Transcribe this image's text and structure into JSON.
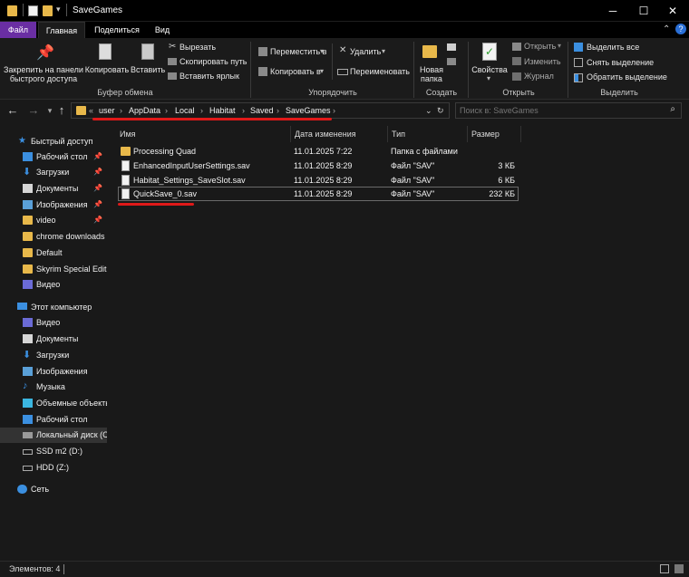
{
  "window": {
    "title": "SaveGames"
  },
  "ribbon_tabs": [
    "Файл",
    "Главная",
    "Поделиться",
    "Вид"
  ],
  "ribbon": {
    "clipboard": {
      "pin_label": "Закрепить на панели быстрого доступа",
      "copy_label": "Копировать",
      "paste_label": "Вставить",
      "cut_label": "Вырезать",
      "copy_path_label": "Скопировать путь",
      "paste_shortcut_label": "Вставить ярлык",
      "group_label": "Буфер обмена"
    },
    "organize": {
      "move_label": "Переместить в",
      "copy_to_label": "Копировать в",
      "delete_label": "Удалить",
      "rename_label": "Переименовать",
      "group_label": "Упорядочить"
    },
    "create": {
      "new_folder_label": "Новая папка",
      "group_label": "Создать"
    },
    "open": {
      "properties_label": "Свойства",
      "open_label": "Открыть",
      "edit_label": "Изменить",
      "history_label": "Журнал",
      "group_label": "Открыть"
    },
    "select": {
      "select_all_label": "Выделить все",
      "select_none_label": "Снять выделение",
      "invert_label": "Обратить выделение",
      "group_label": "Выделить"
    }
  },
  "address": {
    "overflow": "«",
    "crumbs": [
      "user",
      "AppData",
      "Local",
      "Habitat",
      "Saved",
      "SaveGames"
    ],
    "search_placeholder": "Поиск в: SaveGames"
  },
  "nav": {
    "quick_access": "Быстрый доступ",
    "quick_items": [
      "Рабочий стол",
      "Загрузки",
      "Документы",
      "Изображения",
      "video",
      "chrome downloads",
      "Default",
      "Skyrim Special Editi",
      "Видео"
    ],
    "this_pc": "Этот компьютер",
    "pc_items": [
      "Видео",
      "Документы",
      "Загрузки",
      "Изображения",
      "Музыка",
      "Объемные объекты",
      "Рабочий стол",
      "Локальный диск (C",
      "SSD m2 (D:)",
      "HDD (Z:)"
    ],
    "network": "Сеть"
  },
  "columns": [
    "Имя",
    "Дата изменения",
    "Тип",
    "Размер"
  ],
  "files": [
    {
      "name": "Processing Quad",
      "date": "11.01.2025 7:22",
      "type": "Папка с файлами",
      "size": "",
      "kind": "folder"
    },
    {
      "name": "EnhancedInputUserSettings.sav",
      "date": "11.01.2025 8:29",
      "type": "Файл \"SAV\"",
      "size": "3 КБ",
      "kind": "file"
    },
    {
      "name": "Habitat_Settings_SaveSlot.sav",
      "date": "11.01.2025 8:29",
      "type": "Файл \"SAV\"",
      "size": "6 КБ",
      "kind": "file"
    },
    {
      "name": "QuickSave_0.sav",
      "date": "11.01.2025 8:29",
      "type": "Файл \"SAV\"",
      "size": "232 КБ",
      "kind": "file"
    }
  ],
  "status": {
    "items": "Элементов: 4"
  },
  "colors": {
    "accent_file_tab": "#6a2ea3",
    "highlight": "#e01919"
  }
}
